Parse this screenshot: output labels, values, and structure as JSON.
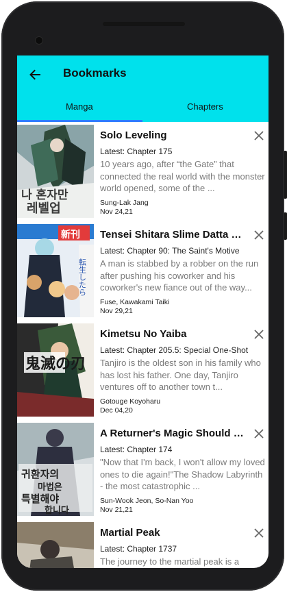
{
  "header": {
    "title": "Bookmarks",
    "back_icon": "arrow-left-icon",
    "background": "#00e1ec"
  },
  "tabs": [
    {
      "label": "Manga",
      "selected": true
    },
    {
      "label": "Chapters",
      "selected": false
    }
  ],
  "accent": "#2e7dff",
  "bookmarks": [
    {
      "title": "Solo Leveling",
      "latest": "Latest: Chapter 175",
      "description": "10 years ago, after “the Gate” that connected the real world with the monster world opened, some of the ...",
      "authors": "Sung-Lak Jang",
      "date": "Nov 24,21",
      "cover_text": "나 혼자만 레벨업"
    },
    {
      "title": "Tensei Shitara Slime Datta Ken",
      "latest": "Latest: Chapter 90: The Saint's Motive",
      "description": "A man is stabbed by a robber on the run after pushing his coworker and his coworker's new fiance out of the way...",
      "authors": "Fuse, Kawakami Taiki",
      "date": "Nov 29,21",
      "cover_text": "転生したらスライムだった件"
    },
    {
      "title": "Kimetsu No Yaiba",
      "latest": "Latest: Chapter 205.5: Special One-Shot",
      "description": "Tanjiro is the oldest son in his family who has lost his father. One day, Tanjiro ventures off to another town t...",
      "authors": "Gotouge Koyoharu",
      "date": "Dec 04,20",
      "cover_text": "鬼滅の刃"
    },
    {
      "title": "A Returner's Magic Should Be Special",
      "latest": "Latest: Chapter 174",
      "description": "\"Now that I'm back, I won't allow my loved ones to die again!\"The Shadow Labyrinth - the most catastrophic ...",
      "authors": "Sun-Wook Jeon, So-Nan Yoo",
      "date": "Nov 21,21",
      "cover_text": "귀환자의 마법은 특별해야 합니다"
    },
    {
      "title": "Martial Peak",
      "latest": "Latest: Chapter 1737",
      "description": "The journey to the martial peak is a lonely, solitary and long one...",
      "authors": "",
      "date": "",
      "cover_text": ""
    }
  ]
}
